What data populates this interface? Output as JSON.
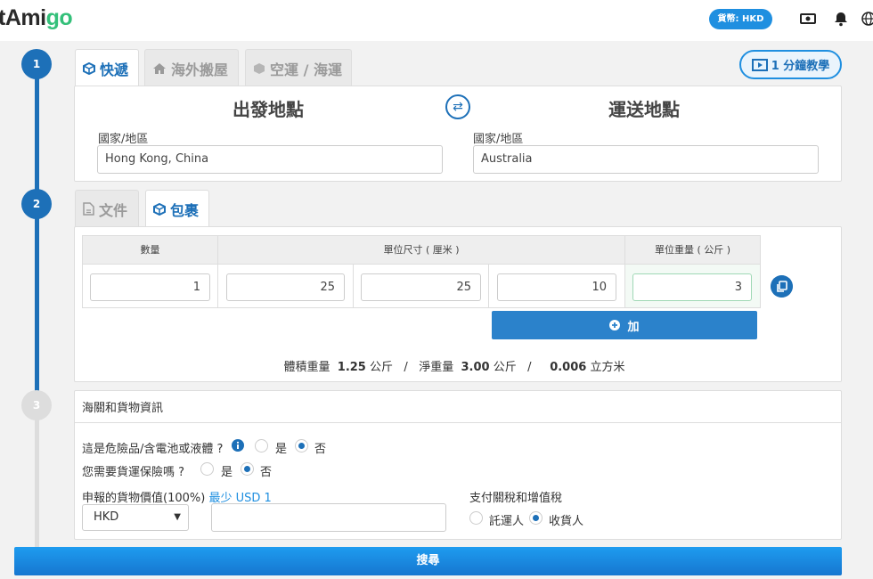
{
  "header": {
    "logo_main": "tAmi",
    "logo_accent": "go",
    "currency_button": "貨幣: HKD",
    "icons": [
      "cash-icon",
      "bell-icon",
      "globe-icon"
    ]
  },
  "steps": [
    "1",
    "2",
    "3"
  ],
  "shipping_tabs": [
    {
      "label": "快遞",
      "icon": "box-icon",
      "active": true
    },
    {
      "label": "海外搬屋",
      "icon": "home-icon",
      "active": false
    },
    {
      "label": "空運 / 海運",
      "icon": "cube-icon",
      "active": false
    }
  ],
  "tutorial_button": "1 分鐘教學",
  "route": {
    "origin_heading": "出發地點",
    "destination_heading": "運送地點",
    "origin_label": "國家/地區",
    "origin_value": "Hong Kong, China",
    "destination_label": "國家/地區",
    "destination_value": "Australia"
  },
  "package_tabs": [
    {
      "label": "文件",
      "icon": "document-icon",
      "active": false
    },
    {
      "label": "包裹",
      "icon": "box-icon",
      "active": true
    }
  ],
  "package_table": {
    "headers": [
      "數量",
      "單位尺寸 ( 厘米 )",
      "單位重量 ( 公斤 )"
    ],
    "row": {
      "quantity": "1",
      "length": "25",
      "width": "25",
      "height": "10",
      "weight": "3"
    }
  },
  "add_button": "加",
  "summary": {
    "vol_label": "體積重量",
    "vol_value": "1.25",
    "unit_kg": "公斤",
    "net_label": "淨重量",
    "net_value": "3.00",
    "cbm_value": "0.006",
    "unit_cbm": "立方米",
    "sep": "/"
  },
  "customs": {
    "title": "海關和貨物資訊",
    "dangerous_q": "這是危險品/含電池或液體 ?",
    "insurance_q": "您需要貨運保險嗎 ?",
    "yes": "是",
    "no": "否",
    "declared_label": "申報的貨物價值(100%)",
    "min_note": "最少 USD 1",
    "currency": "HKD",
    "declared_value": "",
    "duty_label": "支付關稅和增值稅",
    "sender": "託運人",
    "receiver": "收貨人"
  },
  "search_button": "搜尋",
  "colors": {
    "primary": "#1d70b8",
    "accent": "#1f8fe0",
    "logo_green": "#34c07a"
  }
}
